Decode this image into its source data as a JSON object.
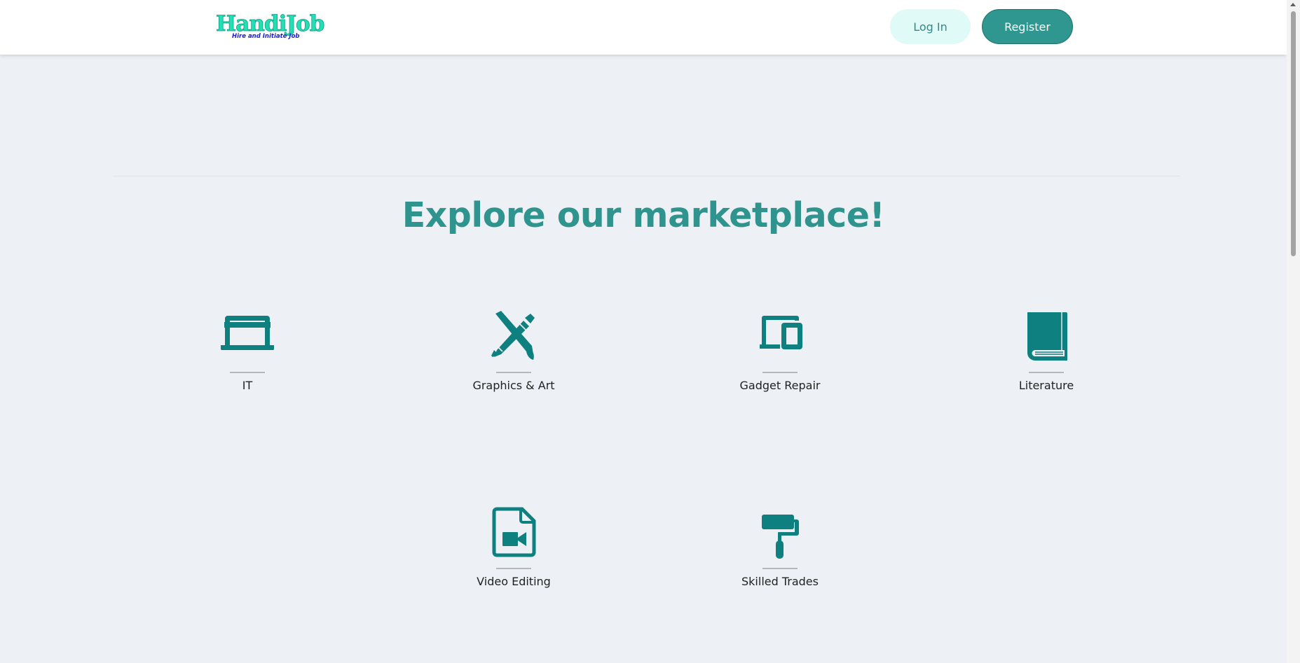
{
  "header": {
    "logo": {
      "title": "HandiJob",
      "tagline": "Hire and Initiate Job"
    },
    "login_label": "Log In",
    "register_label": "Register"
  },
  "main": {
    "heading": "Explore our marketplace!",
    "categories": [
      {
        "label": "IT",
        "icon": "laptop-icon"
      },
      {
        "label": "Graphics & Art",
        "icon": "pencil-brush-icon"
      },
      {
        "label": "Gadget Repair",
        "icon": "laptop-phone-icon"
      },
      {
        "label": "Literature",
        "icon": "book-icon"
      },
      {
        "label": "Video Editing",
        "icon": "video-file-icon"
      },
      {
        "label": "Skilled Trades",
        "icon": "paint-roller-icon"
      }
    ]
  },
  "colors": {
    "brand": "#2f948e",
    "icon": "#0e8080",
    "background": "#edf1f5",
    "logo_green": "#22e0b4",
    "logo_tagline": "#1a1fd8"
  }
}
